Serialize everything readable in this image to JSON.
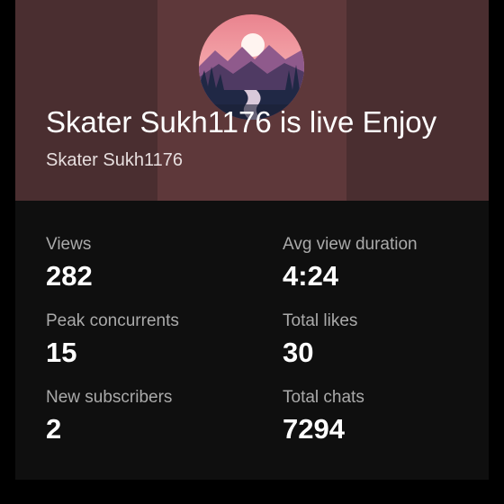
{
  "stream": {
    "title": "Skater Sukh1176 is live Enjoy",
    "channel_name": "Skater Sukh1176",
    "avatar_icon": "landscape-sunset-avatar"
  },
  "stats": [
    {
      "label": "Views",
      "value": "282"
    },
    {
      "label": "Avg view duration",
      "value": "4:24"
    },
    {
      "label": "Peak concurrents",
      "value": "15"
    },
    {
      "label": "Total likes",
      "value": "30"
    },
    {
      "label": "New subscribers",
      "value": "2"
    },
    {
      "label": "Total chats",
      "value": "7294"
    }
  ],
  "colors": {
    "background": "#0f0f0f",
    "header": "#5e383a",
    "label": "#aaaaaa",
    "value": "#ffffff"
  }
}
